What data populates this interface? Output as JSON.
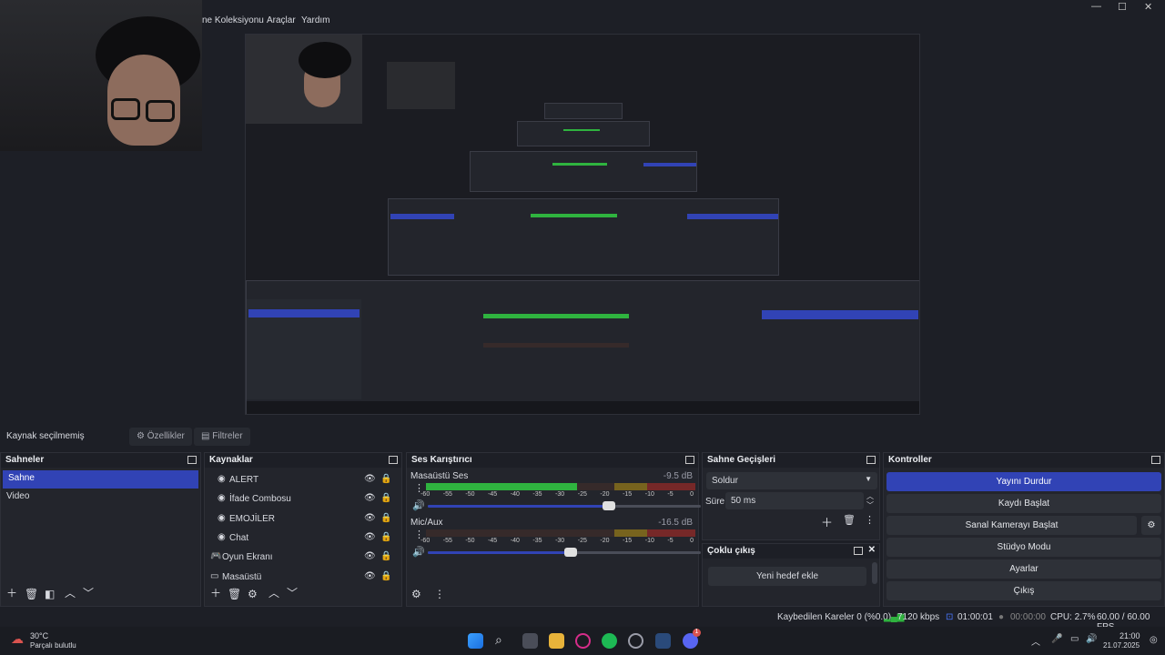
{
  "menu": {
    "items": [
      "ne Koleksiyonu",
      "Araçlar",
      "Yardım"
    ]
  },
  "window_controls": {
    "minimize": "—",
    "maximize": "☐",
    "close": "✕"
  },
  "toolbar": {
    "no_source_label": "Kaynak seçilmemiş",
    "properties_label": "Özellikler",
    "filters_label": "Filtreler"
  },
  "scenes": {
    "title": "Sahneler",
    "items": [
      {
        "label": "Sahne",
        "selected": true
      },
      {
        "label": "Video",
        "selected": false
      }
    ]
  },
  "sources": {
    "title": "Kaynaklar",
    "items": [
      {
        "label": "ALERT",
        "icon": "globe-icon"
      },
      {
        "label": "İfade Combosu",
        "icon": "globe-icon"
      },
      {
        "label": "EMOJİLER",
        "icon": "globe-icon"
      },
      {
        "label": "Chat",
        "icon": "globe-icon"
      },
      {
        "label": "Oyun Ekranı",
        "icon": "gamepad-icon"
      },
      {
        "label": "Masaüstü",
        "icon": "monitor-icon"
      }
    ]
  },
  "mixer": {
    "title": "Ses Karıştırıcı",
    "channels": [
      {
        "name": "Masaüstü Ses",
        "db": "-9.5 dB",
        "level_fraction": 0.56,
        "volume_fraction": 0.66
      },
      {
        "name": "Mic/Aux",
        "db": "-16.5 dB",
        "level_fraction": 0.0,
        "volume_fraction": 0.52
      }
    ],
    "scale": [
      "-60",
      "-55",
      "-50",
      "-45",
      "-40",
      "-35",
      "-30",
      "-25",
      "-20",
      "-15",
      "-10",
      "-5",
      "0"
    ]
  },
  "transitions": {
    "title": "Sahne Geçişleri",
    "transition": "Soldur",
    "duration_label": "Süre",
    "duration": "50 ms"
  },
  "multi_output": {
    "title": "Çoklu çıkış",
    "add_target": "Yeni hedef ekle"
  },
  "controls": {
    "title": "Kontroller",
    "buttons": [
      "Yayını Durdur",
      "Kaydı Başlat",
      "Sanal Kamerayı Başlat",
      "Stüdyo Modu",
      "Ayarlar",
      "Çıkış"
    ]
  },
  "status": {
    "dropped": "Kaybedilen Kareler 0 (%0.0)",
    "bitrate": "7120 kbps",
    "stream_time": "01:00:01",
    "rec_time": "00:00:00",
    "cpu": "CPU: 2.7%",
    "fps": "60.00 / 60.00 FPS"
  },
  "taskbar": {
    "temp": "30°C",
    "weather": "Parçalı bulutlu",
    "time": "21:00",
    "date": "21.07.2025",
    "notification_count": "1"
  },
  "colors": {
    "accent": "#3143b5",
    "meter_green": "#2fb33f",
    "meter_yellow": "#a38a18",
    "meter_red": "#a22828"
  }
}
